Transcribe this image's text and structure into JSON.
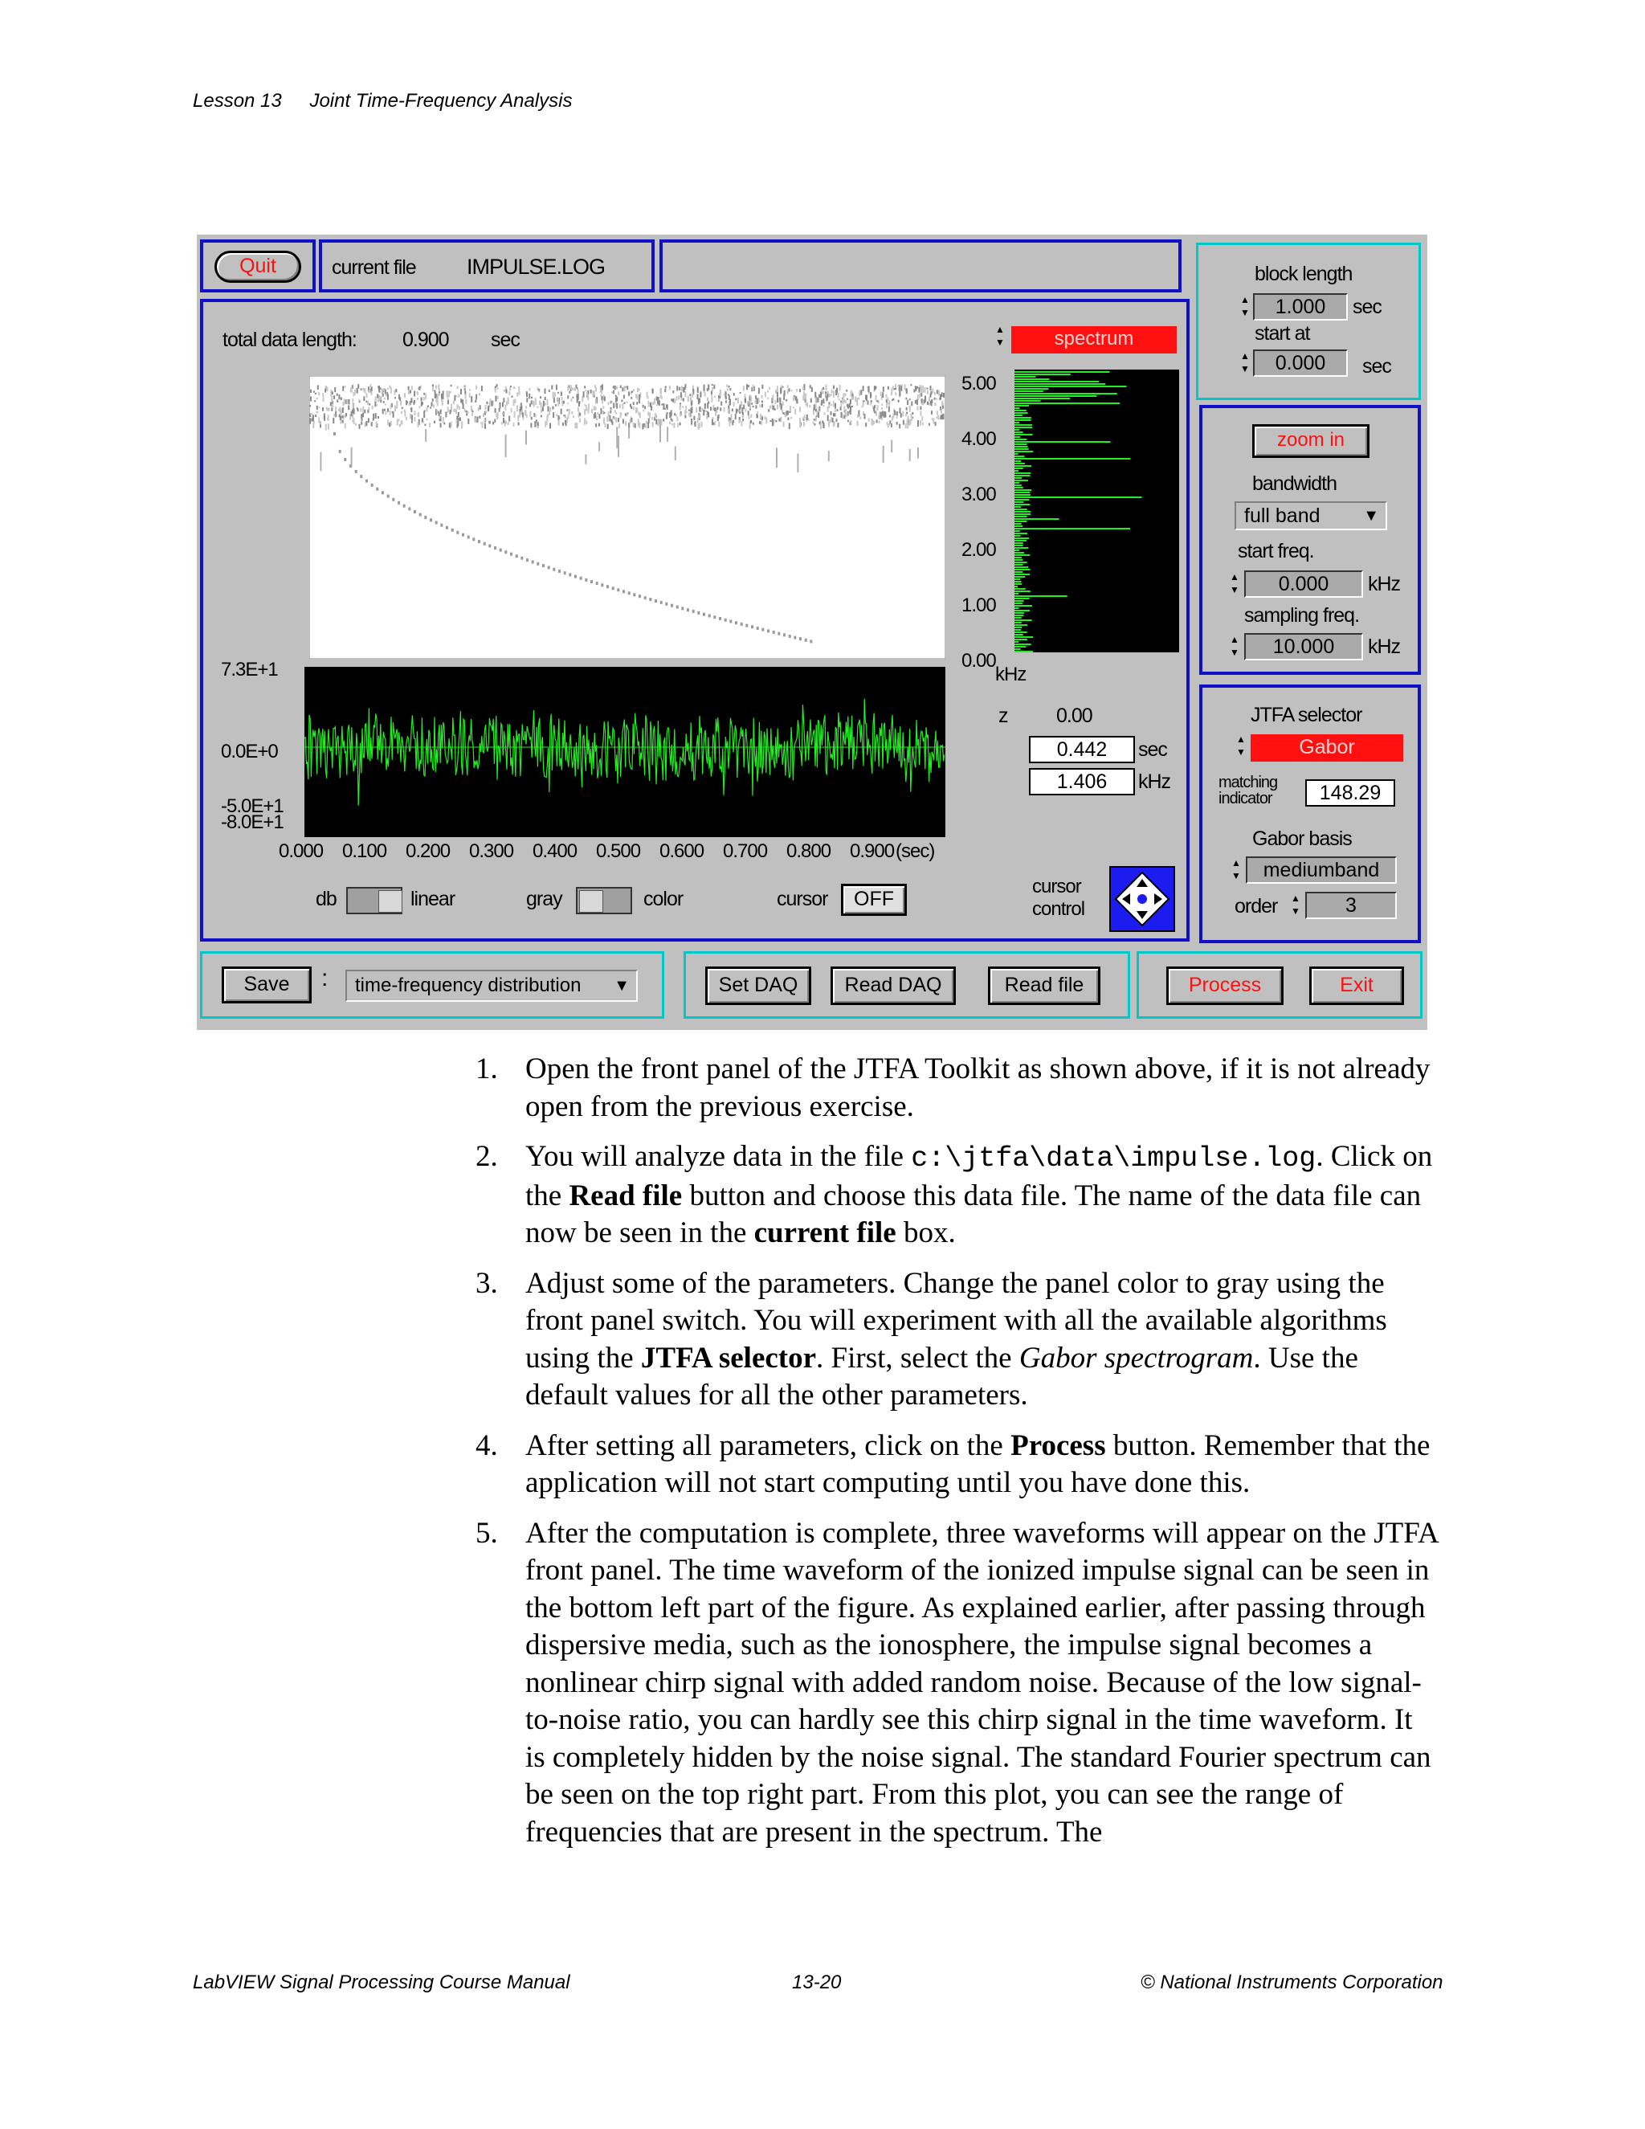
{
  "header": {
    "lesson": "Lesson 13",
    "title": "Joint Time-Frequency Analysis"
  },
  "panel": {
    "quit_label": "Quit",
    "current_file_label": "current file",
    "current_file_value": "IMPULSE.LOG",
    "total_data_length_label": "total data length:",
    "total_data_length_value": "0.900",
    "total_data_length_unit": "sec",
    "spectrum_selector": "spectrum",
    "freq_ticks": [
      "5.00",
      "4.00",
      "3.00",
      "2.00",
      "1.00",
      "0.00"
    ],
    "freq_unit": "kHz",
    "amp_ticks": [
      "7.3E+1",
      "0.0E+0",
      "-5.0E+1",
      "-8.0E+1"
    ],
    "time_ticks": [
      "0.000",
      "0.100",
      "0.200",
      "0.300",
      "0.400",
      "0.500",
      "0.600",
      "0.700",
      "0.800",
      "0.900"
    ],
    "time_unit": "(sec)",
    "cursor_z_label": "z",
    "cursor_z_value": "0.00",
    "cursor_time": "0.442",
    "cursor_time_unit": "sec",
    "cursor_freq": "1.406",
    "cursor_freq_unit": "kHz",
    "cursor_control_label": "cursor control",
    "db_label": "db",
    "linear_label": "linear",
    "gray_label": "gray",
    "color_label": "color",
    "cursor_label": "cursor",
    "cursor_state": "OFF",
    "block_length_label": "block length",
    "block_length_value": "1.000",
    "block_length_unit": "sec",
    "start_at_label": "start at",
    "start_at_value": "0.000",
    "start_at_unit": "sec",
    "zoom_label": "zoom in",
    "bandwidth_label": "bandwidth",
    "bandwidth_value": "full band",
    "start_freq_label": "start freq.",
    "start_freq_value": "0.000",
    "start_freq_unit": "kHz",
    "sampling_freq_label": "sampling freq.",
    "sampling_freq_value": "10.000",
    "sampling_freq_unit": "kHz",
    "jtfa_selector_label": "JTFA selector",
    "jtfa_selector_value": "Gabor",
    "matching_indicator_label_1": "matching",
    "matching_indicator_label_2": "indicator",
    "matching_indicator_value": "148.29",
    "gabor_basis_label": "Gabor basis",
    "gabor_basis_value": "mediumband",
    "order_label": "order",
    "order_value": "3",
    "save_label": "Save",
    "save_option": "time-frequency distribution",
    "set_daq_label": "Set DAQ",
    "read_daq_label": "Read DAQ",
    "read_file_label": "Read file",
    "process_label": "Process",
    "exit_label": "Exit"
  },
  "steps": [
    {
      "n": "1.",
      "text": "Open the front panel of the JTFA Toolkit as shown above, if it is not already open from the previous exercise."
    },
    {
      "n": "2.",
      "a": "You will analyze data in the file ",
      "code": "c:\\jtfa\\data\\impulse.log",
      "b": ". Click on the ",
      "bold1": "Read file",
      "c": " button and choose this data file. The name of the data file can now be seen in the ",
      "bold2": "current file",
      "d": " box."
    },
    {
      "n": "3.",
      "a": "Adjust some of the parameters. Change the panel color to gray using the front panel switch. You will experiment with all the available algorithms using the ",
      "bold1": "JTFA selector",
      "b": ". First, select the ",
      "ital": "Gabor spectrogram",
      "c": ". Use the default values for all the other parameters."
    },
    {
      "n": "4.",
      "a": "After setting all parameters, click on the ",
      "bold1": "Process",
      "b": " button. Remember that the application will not start computing until you have done this."
    },
    {
      "n": "5.",
      "text": "After the computation is complete, three waveforms will appear on the JTFA front panel. The time waveform of the ionized impulse signal can be seen in the bottom left part of the figure. As explained earlier, after passing through dispersive media, such as the ionosphere, the impulse signal becomes a nonlinear chirp signal with added random noise. Because of the low signal-to-noise ratio, you can hardly see this chirp signal in the time waveform. It is completely hidden by the noise signal. The standard Fourier spectrum can be seen on the top right part. From this plot, you can see the range of frequencies that are present in the spectrum. The"
    }
  ],
  "footer": {
    "left": "LabVIEW Signal Processing Course Manual",
    "center": "13-20",
    "right": "© National Instruments Corporation"
  }
}
